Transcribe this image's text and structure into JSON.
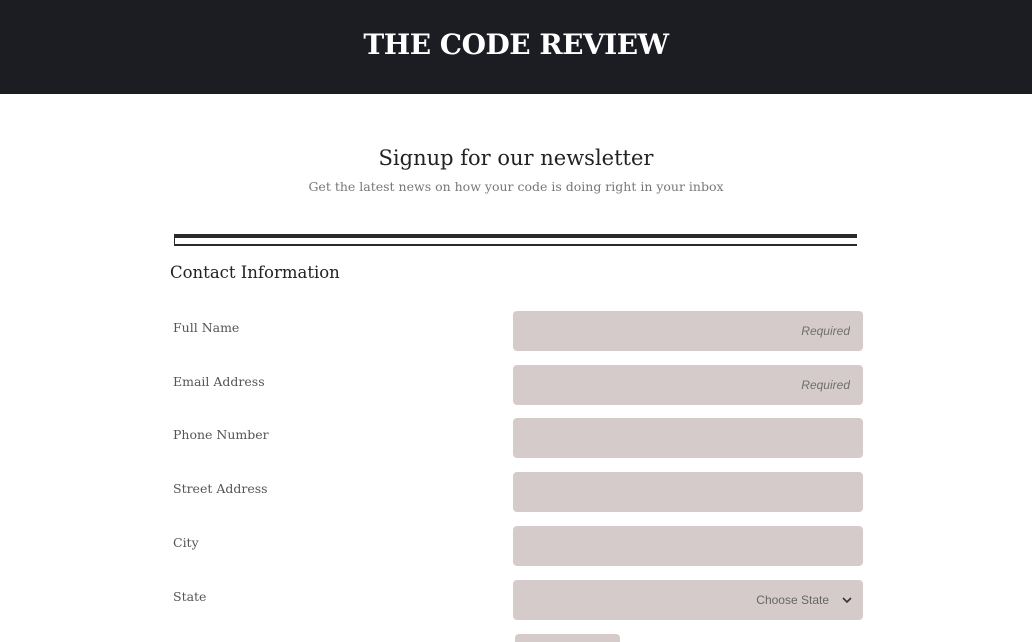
{
  "header": {
    "title": "THE CODE REVIEW"
  },
  "intro": {
    "heading": "Signup for our newsletter",
    "subheading": "Get the latest news on how your code is doing right in your inbox"
  },
  "section": {
    "title": "Contact Information"
  },
  "fields": {
    "full_name": {
      "label": "Full Name",
      "placeholder": "Required"
    },
    "email": {
      "label": "Email Address",
      "placeholder": "Required"
    },
    "phone": {
      "label": "Phone Number",
      "placeholder": ""
    },
    "street": {
      "label": "Street Address",
      "placeholder": ""
    },
    "city": {
      "label": "City",
      "placeholder": ""
    },
    "state": {
      "label": "State",
      "selected": "Choose State"
    }
  }
}
